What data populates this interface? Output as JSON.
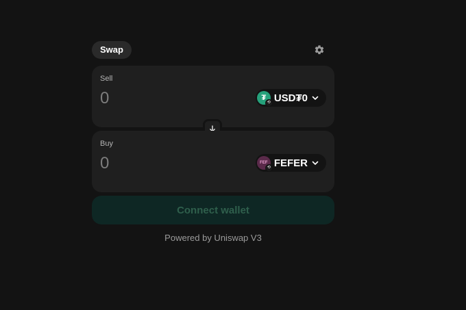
{
  "header": {
    "tab_label": "Swap"
  },
  "sell": {
    "label": "Sell",
    "amount_placeholder": "0",
    "token_symbol": "USD₮0",
    "token_logo_text": "₮",
    "token_color": "#26a17b"
  },
  "buy": {
    "label": "Buy",
    "amount_placeholder": "0",
    "token_symbol": "FEFER",
    "token_logo_text": "FEF",
    "token_color": "#5a2a4a"
  },
  "actions": {
    "connect_label": "Connect wallet"
  },
  "footer": {
    "powered_by": "Powered by Uniswap V3"
  },
  "icons": {
    "settings": "gear-icon",
    "switch": "arrow-down-icon",
    "dropdown": "chevron-down-icon"
  },
  "colors": {
    "background": "#131313",
    "panel": "#1f1f1f",
    "connect_bg": "#0e2724",
    "connect_text": "#2f5f4c"
  }
}
